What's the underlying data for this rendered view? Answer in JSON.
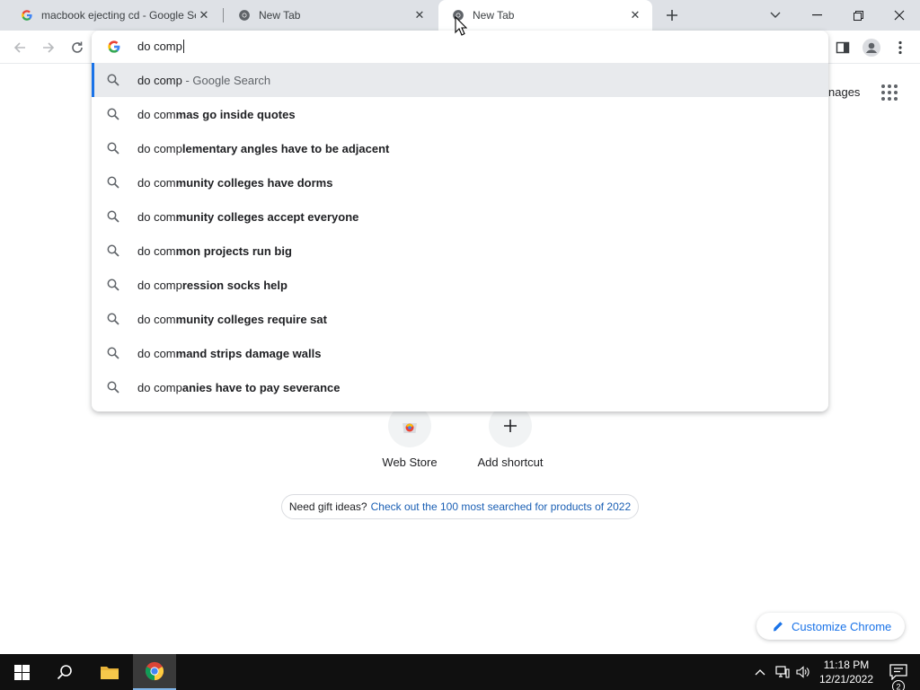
{
  "tabs": [
    {
      "title": "macbook ejecting cd - Google Se",
      "icon": "google-g-icon"
    },
    {
      "title": "New Tab",
      "icon": "chrome-icon"
    },
    {
      "title": "New Tab",
      "icon": "chrome-icon",
      "active": true
    }
  ],
  "omnibox": {
    "typed": "do comp",
    "suggestions": [
      {
        "prefix": "do comp",
        "rest": "",
        "suffix": " - Google Search",
        "selected": true
      },
      {
        "prefix": "do com",
        "rest": "mas go inside quotes"
      },
      {
        "prefix": "do comp",
        "rest": "lementary angles have to be adjacent"
      },
      {
        "prefix": "do com",
        "rest": "munity colleges have dorms"
      },
      {
        "prefix": "do com",
        "rest": "munity colleges accept everyone"
      },
      {
        "prefix": "do com",
        "rest": "mon projects run big"
      },
      {
        "prefix": "do comp",
        "rest": "ression socks help"
      },
      {
        "prefix": "do com",
        "rest": "munity colleges require sat"
      },
      {
        "prefix": "do com",
        "rest": "mand strips damage walls"
      },
      {
        "prefix": "do comp",
        "rest": "anies have to pay severance"
      }
    ]
  },
  "ntp": {
    "images_link": "nages",
    "shortcuts": [
      {
        "label": "Web Store",
        "icon": "chrome-web-store-icon"
      },
      {
        "label": "Add shortcut",
        "icon": "plus-icon"
      }
    ],
    "promo": {
      "lead": "Need gift ideas?",
      "link": "Check out the 100 most searched for products of 2022"
    },
    "customize_label": "Customize Chrome"
  },
  "taskbar": {
    "time": "11:18 PM",
    "date": "12/21/2022",
    "notification_count": "2"
  },
  "colors": {
    "accent": "#1a73e8",
    "tabstrip": "#dee1e6",
    "taskbar": "#101010"
  }
}
